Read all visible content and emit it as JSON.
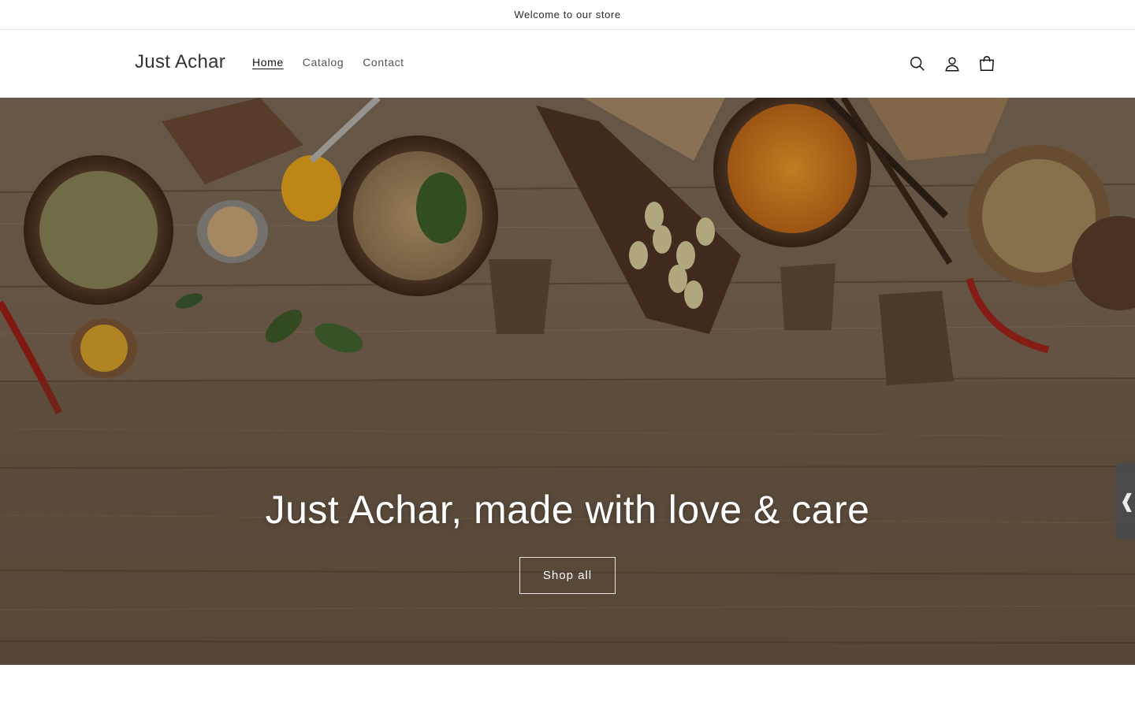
{
  "announcement": {
    "text": "Welcome to our store"
  },
  "header": {
    "logo": "Just Achar",
    "nav": [
      {
        "label": "Home",
        "active": true
      },
      {
        "label": "Catalog",
        "active": false
      },
      {
        "label": "Contact",
        "active": false
      }
    ],
    "icons": [
      "search-icon",
      "account-icon",
      "cart-icon"
    ]
  },
  "hero": {
    "title": "Just Achar, made with love & care",
    "button_label": "Shop all",
    "image_subject": "spices in bowls on rustic wooden table"
  },
  "side_tab": {
    "glyph": "❰"
  },
  "colors": {
    "text": "#121212",
    "hero_text": "#ffffff",
    "wood": "#7a6450"
  }
}
